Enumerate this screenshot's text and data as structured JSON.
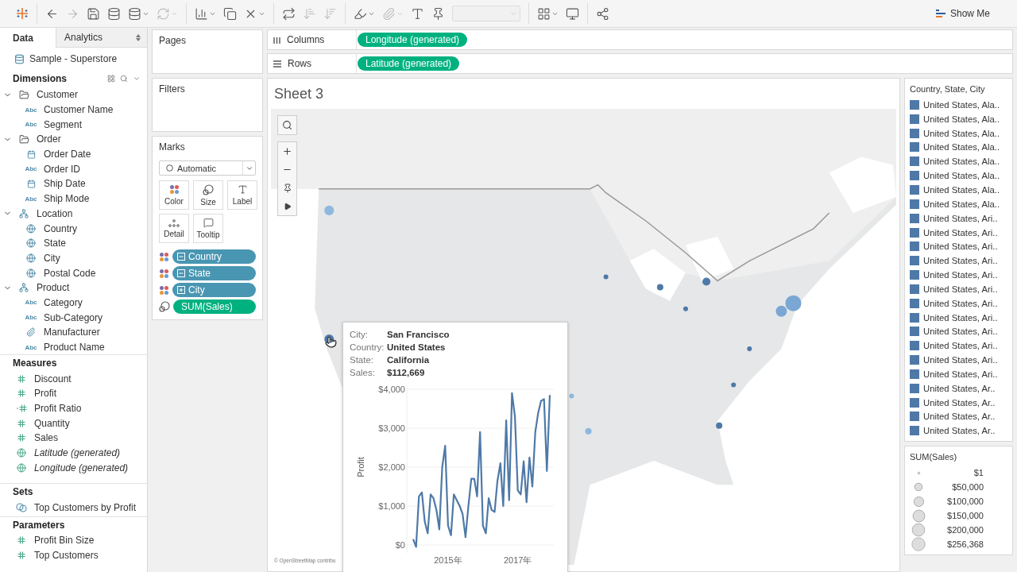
{
  "toolbar": {
    "groups": [
      [
        {
          "kind": "logo"
        }
      ],
      [
        {
          "kind": "back",
          "disabled": false,
          "menu": false
        },
        {
          "kind": "forward",
          "disabled": true,
          "menu": false
        },
        {
          "kind": "save",
          "disabled": false,
          "menu": false
        },
        {
          "kind": "new-datasource",
          "disabled": false,
          "menu": false
        },
        {
          "kind": "pause",
          "disabled": false,
          "menu": true
        },
        {
          "kind": "refresh",
          "disabled": true,
          "menu": true
        }
      ],
      [
        {
          "kind": "new-sheet",
          "disabled": false,
          "menu": true
        },
        {
          "kind": "duplicate",
          "disabled": false,
          "menu": false
        },
        {
          "kind": "clear",
          "disabled": false,
          "menu": true
        }
      ],
      [
        {
          "kind": "swap",
          "disabled": false,
          "menu": false
        },
        {
          "kind": "sort-asc",
          "disabled": true,
          "menu": false
        },
        {
          "kind": "sort-desc",
          "disabled": true,
          "menu": false
        }
      ],
      [
        {
          "kind": "highlight",
          "disabled": false,
          "menu": true
        },
        {
          "kind": "group",
          "disabled": true,
          "menu": true
        },
        {
          "kind": "label",
          "disabled": false,
          "menu": false
        },
        {
          "kind": "pin",
          "disabled": false,
          "menu": false
        },
        {
          "kind": "select",
          "disabled": true
        }
      ],
      [
        {
          "kind": "fit",
          "disabled": false,
          "menu": true
        },
        {
          "kind": "present",
          "disabled": false,
          "menu": false
        }
      ],
      [
        {
          "kind": "share",
          "disabled": false,
          "menu": false
        }
      ]
    ],
    "show_me": "Show Me"
  },
  "data_pane": {
    "tabs": [
      {
        "label": "Data",
        "selected": true
      },
      {
        "label": "Analytics",
        "selected": false
      }
    ],
    "datasource": "Sample - Superstore",
    "dimensions": {
      "title": "Dimensions",
      "items": [
        {
          "label": "Customer",
          "kind": "folder",
          "expanded": true,
          "children": [
            {
              "label": "Customer Name",
              "kind": "string",
              "glyph": "Abc"
            },
            {
              "label": "Segment",
              "kind": "string",
              "glyph": "Abc"
            }
          ]
        },
        {
          "label": "Order",
          "kind": "folder",
          "expanded": true,
          "children": [
            {
              "label": "Order Date",
              "kind": "date"
            },
            {
              "label": "Order ID",
              "kind": "string",
              "glyph": "Abc"
            },
            {
              "label": "Ship Date",
              "kind": "date"
            },
            {
              "label": "Ship Mode",
              "kind": "string",
              "glyph": "Abc"
            }
          ]
        },
        {
          "label": "Location",
          "kind": "hierarchy",
          "expanded": true,
          "children": [
            {
              "label": "Country",
              "kind": "geo"
            },
            {
              "label": "State",
              "kind": "geo"
            },
            {
              "label": "City",
              "kind": "geo"
            },
            {
              "label": "Postal Code",
              "kind": "geo"
            }
          ]
        },
        {
          "label": "Product",
          "kind": "hierarchy",
          "expanded": true,
          "children": [
            {
              "label": "Category",
              "kind": "string",
              "glyph": "Abc"
            },
            {
              "label": "Sub-Category",
              "kind": "string",
              "glyph": "Abc"
            },
            {
              "label": "Manufacturer",
              "kind": "clip"
            },
            {
              "label": "Product Name",
              "kind": "string",
              "glyph": "Abc"
            }
          ]
        }
      ]
    },
    "measures": {
      "title": "Measures",
      "items": [
        {
          "label": "Discount",
          "kind": "number",
          "generated": false
        },
        {
          "label": "Profit",
          "kind": "number",
          "generated": false
        },
        {
          "label": "Profit Ratio",
          "kind": "calc",
          "generated": false
        },
        {
          "label": "Quantity",
          "kind": "number",
          "generated": false
        },
        {
          "label": "Sales",
          "kind": "number",
          "generated": false
        },
        {
          "label": "Latitude (generated)",
          "kind": "geo",
          "generated": true
        },
        {
          "label": "Longitude (generated)",
          "kind": "geo",
          "generated": true
        }
      ]
    },
    "sets": {
      "title": "Sets",
      "items": [
        {
          "label": "Top Customers by Profit",
          "kind": "set"
        }
      ]
    },
    "parameters": {
      "title": "Parameters",
      "items": [
        {
          "label": "Profit Bin Size",
          "kind": "number"
        },
        {
          "label": "Top Customers",
          "kind": "number"
        }
      ]
    }
  },
  "pages": {
    "title": "Pages"
  },
  "filters": {
    "title": "Filters"
  },
  "marks": {
    "title": "Marks",
    "mark_type": "Automatic",
    "cards": [
      {
        "label": "Color",
        "kind": "color"
      },
      {
        "label": "Size",
        "kind": "size"
      },
      {
        "label": "Label",
        "kind": "label"
      },
      {
        "label": "Detail",
        "kind": "detail"
      },
      {
        "label": "Tooltip",
        "kind": "tooltip"
      }
    ],
    "pills": [
      {
        "label": "Country",
        "kind": "color",
        "measure": false,
        "expanded": true
      },
      {
        "label": "State",
        "kind": "color",
        "measure": false,
        "expanded": true
      },
      {
        "label": "City",
        "kind": "color",
        "measure": false,
        "expanded": false
      },
      {
        "label": "SUM(Sales)",
        "kind": "size",
        "measure": true
      }
    ]
  },
  "shelves": [
    {
      "label": "Columns",
      "kind": "columns",
      "pill": "Longitude (generated)"
    },
    {
      "label": "Rows",
      "kind": "rows",
      "pill": "Latitude (generated)"
    }
  ],
  "sheet": {
    "title": "Sheet 3",
    "attribution": "© OpenStreetMap contribu",
    "tooltip": {
      "fields": [
        {
          "label": "City:",
          "value": "San Francisco"
        },
        {
          "label": "Country:",
          "value": "United States"
        },
        {
          "label": "State:",
          "value": "California"
        },
        {
          "label": "Sales:",
          "value": "$112,669"
        }
      ],
      "chart_data": {
        "type": "line",
        "ylabel": "Profit",
        "categories": [
          null,
          null,
          null,
          null,
          null,
          null,
          null,
          null,
          null,
          null,
          null,
          null,
          "2015年",
          null,
          null,
          null,
          null,
          null,
          null,
          null,
          null,
          null,
          null,
          null,
          null,
          null,
          null,
          null,
          null,
          null,
          null,
          null,
          null,
          null,
          null,
          null,
          "2017年",
          null,
          null,
          null,
          null,
          null,
          null,
          null,
          null,
          null,
          null,
          null
        ],
        "series": [
          {
            "color": "#4e79a7",
            "values": [
              150,
              -50,
              1250,
              1350,
              600,
              300,
              1300,
              1200,
              900,
              400,
              2000,
              2550,
              500,
              250,
              1300,
              1150,
              1000,
              800,
              200,
              1000,
              1700,
              1700,
              1250,
              2900,
              500,
              300,
              1200,
              900,
              850,
              1650,
              2100,
              1000,
              3200,
              1150,
              3900,
              3300,
              1400,
              1300,
              2150,
              1100,
              2250,
              1500,
              2900,
              3400,
              3700,
              3750,
              1900,
              3850
            ]
          }
        ],
        "ylim": [
          -150,
          4000
        ],
        "grid": true,
        "yticks": [
          {
            "value": 0,
            "label": "$0"
          },
          {
            "value": 1000,
            "label": "$1,000"
          },
          {
            "value": 2000,
            "label": "$2,000"
          },
          {
            "value": 3000,
            "label": "$3,000"
          },
          {
            "value": 4000,
            "label": "$4,000"
          }
        ]
      }
    }
  },
  "color_legend": {
    "title": "Country, State, City",
    "items": [
      {
        "label": "United States, Ala..",
        "color": "#4e79a7"
      },
      {
        "label": "United States, Ala..",
        "color": "#4e79a7"
      },
      {
        "label": "United States, Ala..",
        "color": "#4e79a7"
      },
      {
        "label": "United States, Ala..",
        "color": "#4e79a7"
      },
      {
        "label": "United States, Ala..",
        "color": "#4e79a7"
      },
      {
        "label": "United States, Ala..",
        "color": "#4e79a7"
      },
      {
        "label": "United States, Ala..",
        "color": "#4e79a7"
      },
      {
        "label": "United States, Ala..",
        "color": "#4e79a7"
      },
      {
        "label": "United States, Ari..",
        "color": "#4e79a7"
      },
      {
        "label": "United States, Ari..",
        "color": "#4e79a7"
      },
      {
        "label": "United States, Ari..",
        "color": "#4e79a7"
      },
      {
        "label": "United States, Ari..",
        "color": "#4e79a7"
      },
      {
        "label": "United States, Ari..",
        "color": "#4e79a7"
      },
      {
        "label": "United States, Ari..",
        "color": "#4e79a7"
      },
      {
        "label": "United States, Ari..",
        "color": "#4e79a7"
      },
      {
        "label": "United States, Ari..",
        "color": "#4e79a7"
      },
      {
        "label": "United States, Ari..",
        "color": "#4e79a7"
      },
      {
        "label": "United States, Ari..",
        "color": "#4e79a7"
      },
      {
        "label": "United States, Ari..",
        "color": "#4e79a7"
      },
      {
        "label": "United States, Ari..",
        "color": "#4e79a7"
      },
      {
        "label": "United States, Ar..",
        "color": "#4e79a7"
      },
      {
        "label": "United States, Ar..",
        "color": "#4e79a7"
      },
      {
        "label": "United States, Ar..",
        "color": "#4e79a7"
      },
      {
        "label": "United States, Ar..",
        "color": "#4e79a7"
      }
    ]
  },
  "size_legend": {
    "title": "SUM(Sales)",
    "items": [
      "$1",
      "$50,000",
      "$100,000",
      "$150,000",
      "$200,000",
      "$256,368"
    ]
  }
}
